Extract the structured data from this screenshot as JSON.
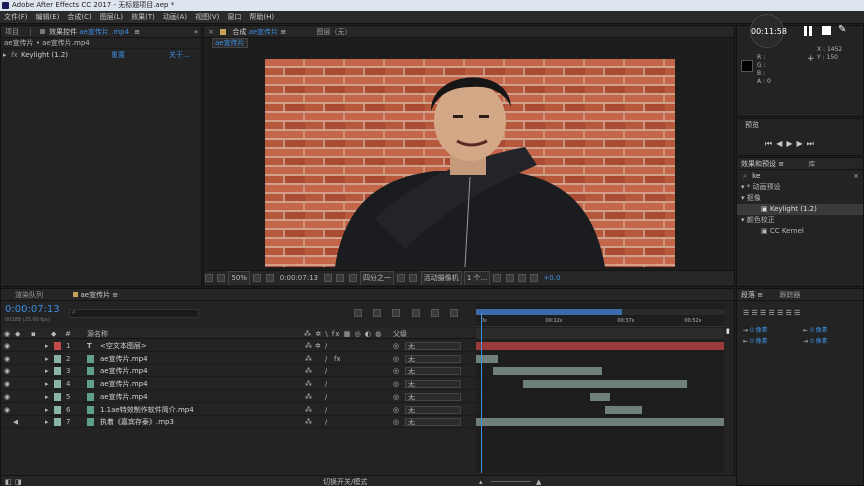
{
  "title_bar": {
    "text": "Adobe After Effects CC 2017 - 无标题项目.aep *"
  },
  "menu": [
    "文件(F)",
    "编辑(E)",
    "合成(C)",
    "图层(L)",
    "效果(T)",
    "动画(A)",
    "视图(V)",
    "窗口",
    "帮助(H)"
  ],
  "project_panel": {
    "tab": "项目"
  },
  "effect_controls": {
    "tab_label": "效果控件",
    "tab_file": "ae宣传片 .mp4",
    "breadcrumb": "ae宣传片 • ae宣传片.mp4",
    "effect_name": "Keylight (1.2)",
    "reset": "重置",
    "about": "关于..."
  },
  "composition": {
    "tab_label": "合成",
    "tab_name": "ae宣传片",
    "layer_tab": "图层（无）",
    "sub_tab": "ae宣传片",
    "zoom": "50%",
    "timecode": "0:00:07:13",
    "resolution": "四分之一",
    "camera": "活动摄像机",
    "views": "1 个...",
    "exposure": "+0.0"
  },
  "info_panel": {
    "r": "R :",
    "g": "G :",
    "b": "B :",
    "a": "A : 0",
    "x": "X : 1452",
    "y": "Y : 150",
    "plus": "+"
  },
  "recording": {
    "time": "00:11:58"
  },
  "preview": {
    "title": "预览"
  },
  "effects_presets": {
    "tab": "效果和预设",
    "library_tab": "库",
    "search": "ke",
    "items": [
      {
        "label": "* 动画预设",
        "indent": 0
      },
      {
        "label": "抠像",
        "indent": 0
      },
      {
        "label": "Keylight (1.2)",
        "indent": 2,
        "selected": true
      },
      {
        "label": "颜色校正",
        "indent": 0
      },
      {
        "label": "CC Kernel",
        "indent": 2
      }
    ]
  },
  "paragraph_panel": {
    "tab": "段落",
    "tracker_tab": "跟踪器",
    "px1": "0 像素",
    "px2": "0 像素",
    "px3": "0 像素",
    "px4": "0 像素",
    "px5": "0 像素"
  },
  "timeline": {
    "render_queue_tab": "渲染队列",
    "comp_tab": "ae宣传片",
    "timecode": "0:00:07:13",
    "frames": "00188 (25.00 fps)",
    "col_source": "源名称",
    "col_parent": "父级",
    "ruler": [
      "0s",
      "00:12s",
      "00:37s",
      "00:52s"
    ],
    "bottom_toggle": "切换开关/模式",
    "layers": [
      {
        "num": "1",
        "name": "<空文本图层>",
        "color": "#c24a4a",
        "type": "T",
        "parent": "无",
        "bar_start": 0.0,
        "bar_end": 1.0
      },
      {
        "num": "2",
        "name": "ae宣传片.mp4",
        "color": "#8ab4a8",
        "type": "v",
        "parent": "无",
        "bar_start": 0.0,
        "bar_end": 0.09
      },
      {
        "num": "3",
        "name": "ae宣传片.mp4",
        "color": "#8ab4a8",
        "type": "v",
        "parent": "无",
        "bar_start": 0.07,
        "bar_end": 0.51
      },
      {
        "num": "4",
        "name": "ae宣传片.mp4",
        "color": "#8ab4a8",
        "type": "v",
        "parent": "无",
        "bar_start": 0.19,
        "bar_end": 0.85
      },
      {
        "num": "5",
        "name": "ae宣传片.mp4",
        "color": "#8ab4a8",
        "type": "v",
        "parent": "无",
        "bar_start": 0.46,
        "bar_end": 0.54
      },
      {
        "num": "6",
        "name": "1.1ae特效制作软件简介.mp4",
        "color": "#8ab4a8",
        "type": "v",
        "parent": "无",
        "bar_start": 0.52,
        "bar_end": 0.67
      },
      {
        "num": "7",
        "name": "执着《嘉宾存泰》.mp3",
        "color": "#8ab4a8",
        "type": "a",
        "parent": "无",
        "bar_start": 0.0,
        "bar_end": 1.0
      }
    ],
    "playhead": 0.02,
    "work_end": 0.59
  },
  "colors": {
    "accent": "#3d8fe0",
    "layer_red": "#c24a4a",
    "layer_teal": "#8ab4a8",
    "bar": "#6f7f7b",
    "brick": "#b5553a"
  }
}
